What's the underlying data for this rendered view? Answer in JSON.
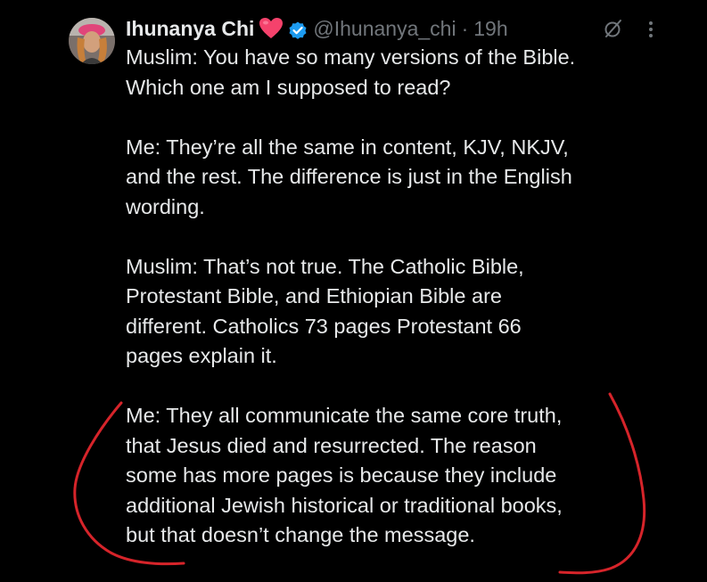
{
  "author": {
    "display_name": "Ihunanya Chi",
    "name_emoji_icon": "red-heart-icon",
    "verified_icon": "verified-badge-icon",
    "handle": "@Ihunanya_chi",
    "separator": "·",
    "timestamp": "19h",
    "avatar_icon": "profile-photo"
  },
  "actions": {
    "grok_icon": "grok-slash-icon",
    "more_icon": "more-vertical-icon"
  },
  "tweet": {
    "paragraphs": [
      "Muslim: You have so many versions of the Bible.\nWhich one am I supposed to read?",
      "Me: They’re all the same in content, KJV, NKJV,\nand the rest. The difference is just in the English\nwording.",
      "Muslim: That’s not true. The Catholic Bible,\nProtestant Bible, and Ethiopian Bible are\ndifferent. Catholics 73 pages Protestant 66\npages explain it.",
      "Me: They all communicate the same core truth,\nthat Jesus died and resurrected. The reason\nsome has more pages is because they include\nadditional Jewish historical or traditional books,\nbut that doesn’t change the message."
    ]
  },
  "colors": {
    "background": "#000000",
    "text_primary": "#e7e9ea",
    "text_secondary": "#71767b",
    "verified_blue": "#1d9bf0",
    "heart_pink": "#f5426c",
    "annotation_red": "#d6242a"
  }
}
